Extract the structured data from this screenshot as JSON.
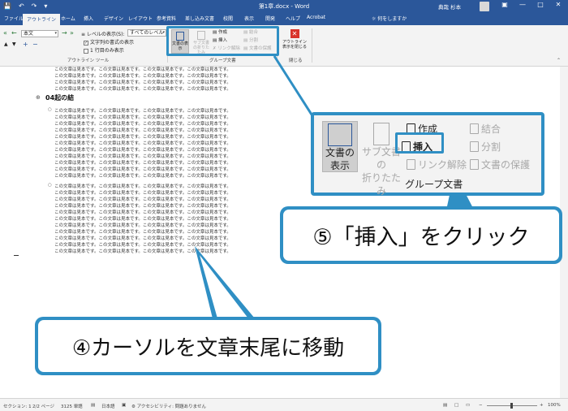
{
  "titlebar": {
    "document_title": "第1章.docx - Word",
    "user_name": "典哉 杉本",
    "qat": [
      "save-icon",
      "undo-icon",
      "redo-icon",
      "customize-icon"
    ],
    "window_controls": [
      "ribbon-options-icon",
      "minimize-icon",
      "restore-icon",
      "close-icon"
    ]
  },
  "tabs": [
    "ファイル",
    "アウトライン",
    "ホーム",
    "挿入",
    "デザイン",
    "レイアウト",
    "参考資料",
    "差し込み文書",
    "校閲",
    "表示",
    "開発",
    "ヘルプ",
    "Acrobat"
  ],
  "tell_me": "何をしますか",
  "ribbon": {
    "outline_tools": {
      "level_combo_value": "本文",
      "show_level_label": "レベルの表示(S):",
      "show_level_value": "すべてのレベル",
      "text_formatting_label": "文字列の書式の表示",
      "first_line_label": "1 行目のみ表示",
      "group_label": "アウトライン ツール"
    },
    "master_document": {
      "show_document": "文書の表示",
      "collapse_sub": "サブ文書の折りたたみ",
      "create": "作成",
      "insert": "挿入",
      "unlink": "リンク解除",
      "merge": "結合",
      "split": "分割",
      "lock": "文書の保護",
      "group_label": "グループ文書"
    },
    "close": {
      "button_line1": "アウトライン",
      "button_line2": "表示を閉じる",
      "group_label": "閉じる"
    }
  },
  "document": {
    "heading": "04起の結",
    "body_line": "この文章は見本です。この文章は見本です。この文章は見本です。この文章は見本です。"
  },
  "zoom": {
    "show_document_line1": "文書の",
    "show_document_line2": "表示",
    "collapse_sub_line1": "サブ文書の",
    "collapse_sub_line2": "折りたたみ",
    "create": "作成",
    "insert": "挿入",
    "unlink": "リンク解除",
    "merge": "結合",
    "split": "分割",
    "lock": "文書の保護",
    "group_label": "グループ文書"
  },
  "callouts": {
    "step5": "⑤「挿入」をクリック",
    "step4": "④カーソルを文章末尾に移動"
  },
  "status": {
    "section": "セクション: 1",
    "page": "2/2 ページ",
    "words": "3125 単語",
    "language": "日本語",
    "accessibility": "アクセシビリティ: 問題ありません",
    "zoom": "100%"
  },
  "colors": {
    "word_blue": "#2b579a",
    "callout_blue": "#2f8fc4",
    "close_red": "#d9342b"
  }
}
